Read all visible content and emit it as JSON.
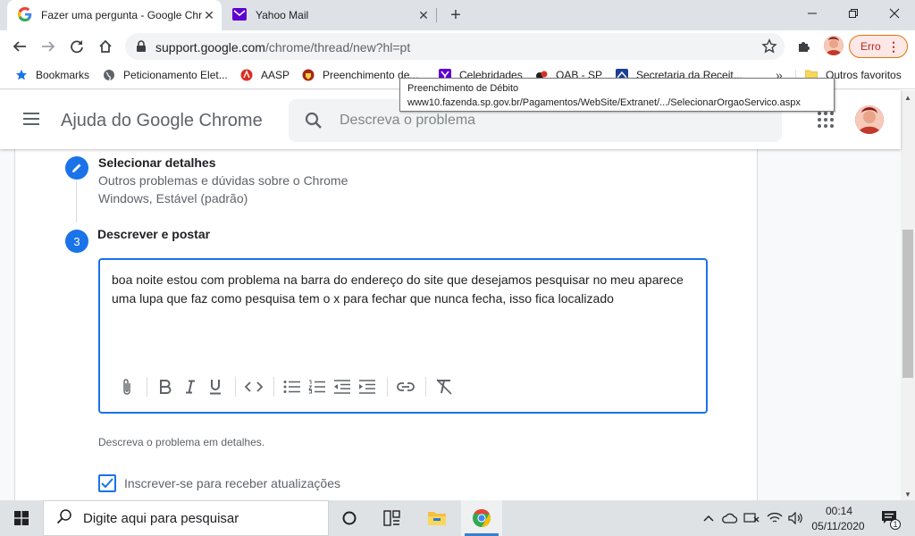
{
  "browser": {
    "tabs": [
      {
        "title": "Fazer uma pergunta - Google Chrome",
        "active": true
      },
      {
        "title": "Yahoo Mail",
        "active": false
      }
    ],
    "new_tab_symbol": "+",
    "close_symbol": "✕",
    "address": {
      "host": "support.google.com",
      "path": "/chrome/thread/new?hl=pt"
    },
    "error_button_label": "Erro",
    "bookmarks": [
      {
        "label": "Bookmarks",
        "icon": "star-icon"
      },
      {
        "label": "Peticionamento Elet...",
        "icon": "globe-icon"
      },
      {
        "label": "AASP",
        "icon": "aasp-icon"
      },
      {
        "label": "Preenchimento de...",
        "icon": "sp-crest-icon"
      },
      {
        "label": "Celebridades",
        "icon": "yahoo-icon"
      },
      {
        "label": "OAB - SP",
        "icon": "oab-icon"
      },
      {
        "label": "Secretaria da Receit...",
        "icon": "receita-icon"
      }
    ],
    "bookmarks_more_symbol": "»",
    "other_bookmarks": "Outros favoritos",
    "tooltip": {
      "line1": "Preenchimento de Débito",
      "line2": "www10.fazenda.sp.gov.br/Pagamentos/WebSite/Extranet/.../SelecionarOrgaoServico.aspx"
    }
  },
  "page": {
    "title": "Ajuda do Google Chrome",
    "search_placeholder": "Descreva o problema",
    "step2": {
      "title": "Selecionar detalhes",
      "detail1": "Outros problemas e dúvidas sobre o Chrome",
      "detail2": "Windows, Estável (padrão)"
    },
    "step3": {
      "number": "3",
      "title": "Descrever e postar"
    },
    "editor_text": "boa noite estou com problema na barra do endereço do site que desejamos pesquisar no meu aparece uma lupa que faz como pesquisa tem o x para fechar que nunca fecha, isso fica localizado",
    "editor_hint": "Descreva o problema em detalhes.",
    "subscribe_label": "Inscrever-se para receber atualizações",
    "subscribe_checked": true
  },
  "taskbar": {
    "search_placeholder": "Digite aqui para pesquisar",
    "time": "00:14",
    "date": "05/11/2020",
    "notification_count": "1"
  },
  "colors": {
    "accent": "#1a73e8",
    "error": "#c5221f"
  }
}
